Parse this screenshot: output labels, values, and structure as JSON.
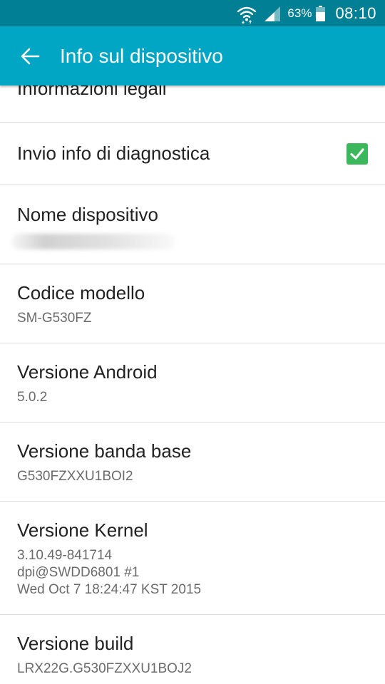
{
  "status_bar": {
    "battery_percent": "63%",
    "time": "08:10",
    "icons": [
      "wifi-icon",
      "signal-icon",
      "battery-icon"
    ]
  },
  "app_bar": {
    "title": "Info sul dispositivo",
    "back_icon": "arrow-back-icon"
  },
  "colors": {
    "status_bar": "#007f95",
    "app_bar": "#00a6c4",
    "checkbox": "#3bb85b"
  },
  "settings": {
    "legal": {
      "title": "Informazioni legali"
    },
    "diagnostics": {
      "title": "Invio info di diagnostica",
      "checked": true
    },
    "device_name": {
      "title": "Nome dispositivo"
    },
    "model": {
      "title": "Codice modello",
      "value": "SM-G530FZ"
    },
    "android_version": {
      "title": "Versione Android",
      "value": "5.0.2"
    },
    "baseband": {
      "title": "Versione banda base",
      "value": "G530FZXXU1BOI2"
    },
    "kernel": {
      "title": "Versione Kernel",
      "value": "3.10.49-841714\ndpi@SWDD6801 #1\nWed Oct 7 18:24:47 KST 2015"
    },
    "build": {
      "title": "Versione build",
      "value": "LRX22G.G530FZXXU1BOJ2"
    }
  }
}
